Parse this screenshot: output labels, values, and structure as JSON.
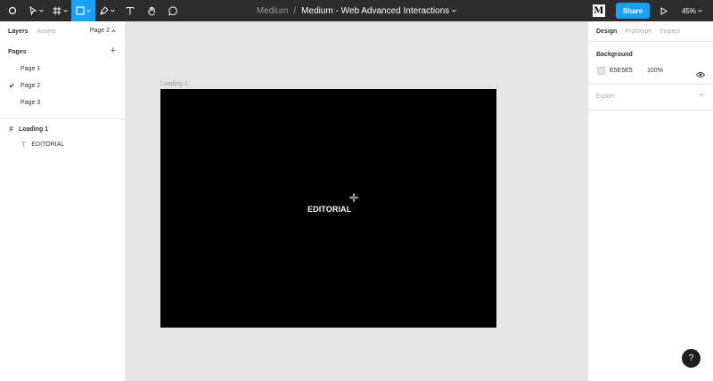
{
  "toolbar": {
    "project": "Medium",
    "separator": "/",
    "document_title": "Medium - Web Advanced Interactions",
    "tools": [
      {
        "icon": "move-icon"
      },
      {
        "icon": "frame-icon"
      },
      {
        "icon": "rectangle-icon",
        "active": true
      },
      {
        "icon": "pen-icon"
      },
      {
        "icon": "text-icon"
      },
      {
        "icon": "hand-icon"
      },
      {
        "icon": "comment-icon"
      }
    ],
    "avatar_letter": "M",
    "share_label": "Share",
    "zoom": "45%"
  },
  "left_panel": {
    "tabs": [
      "Layers",
      "Assets"
    ],
    "current_page": "Page 2",
    "pages_heading": "Pages",
    "pages": [
      "Page 1",
      "Page 2",
      "Page 3"
    ],
    "selected_page": "Page 2",
    "layers": [
      {
        "name": "Loading 1",
        "type": "frame"
      },
      {
        "name": "EDITORIAL",
        "type": "text"
      }
    ]
  },
  "canvas": {
    "frame_label": "Loading 1",
    "frame_text": "EDITORIAL",
    "frame_color": "#000000"
  },
  "right_panel": {
    "tabs": [
      "Design",
      "Prototype",
      "Inspect"
    ],
    "background_heading": "Background",
    "background_hex": "E5E5E5",
    "background_opacity": "100%",
    "export_heading": "Export"
  },
  "colors": {
    "toolbar": "#2c2c2c",
    "accent": "#18a0fb",
    "canvas": "#e5e5e5"
  },
  "help_label": "?"
}
